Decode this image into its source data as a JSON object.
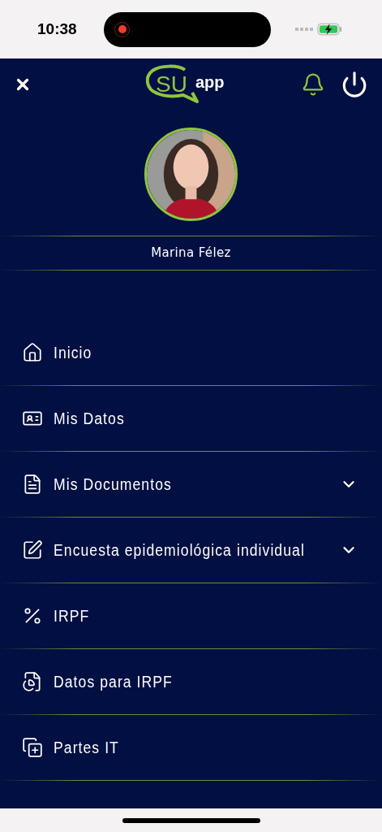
{
  "status_bar": {
    "time": "10:38",
    "recording": true
  },
  "header": {
    "logo": {
      "primary": "SU",
      "secondary": "app"
    }
  },
  "profile": {
    "name": "Marina Félez"
  },
  "menu": [
    {
      "label": "Inicio",
      "kind": "home",
      "expandable": false
    },
    {
      "label": "Mis Datos",
      "kind": "profile",
      "expandable": false
    },
    {
      "label": "Mis Documentos",
      "kind": "documents",
      "expandable": true
    },
    {
      "label": "Encuesta epidemiológica individual",
      "kind": "survey",
      "expandable": true
    },
    {
      "label": "IRPF",
      "kind": "tax",
      "expandable": false
    },
    {
      "label": "Datos para IRPF",
      "kind": "taxdata",
      "expandable": false
    },
    {
      "label": "Partes IT",
      "kind": "leave",
      "expandable": false
    }
  ]
}
